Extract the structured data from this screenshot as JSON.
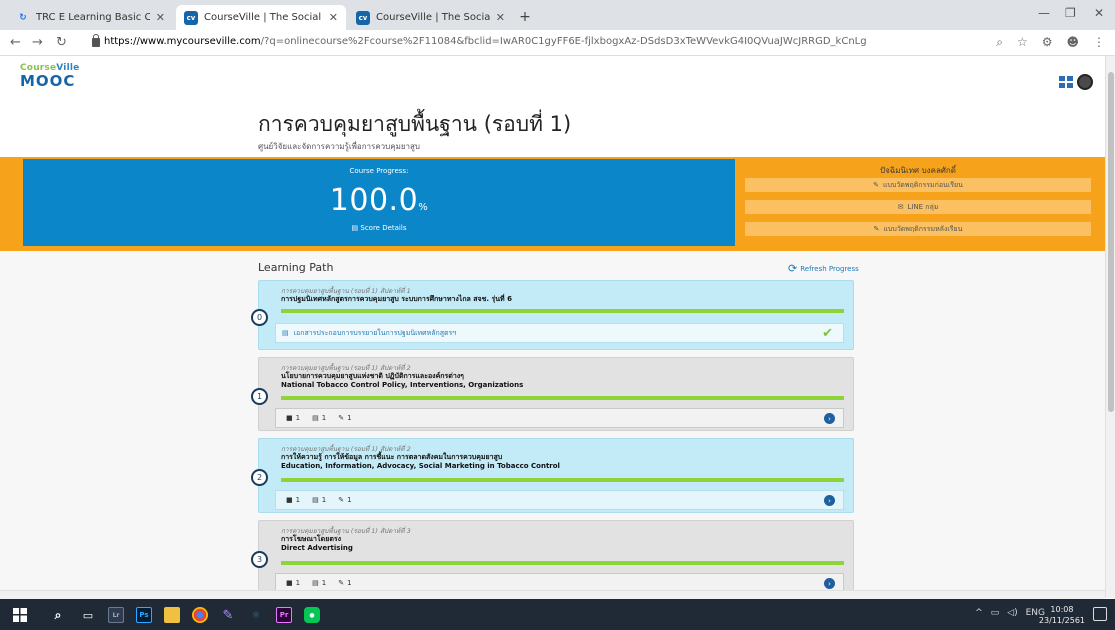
{
  "browser": {
    "tabs": [
      {
        "title": "TRC E Learning Basic Course",
        "active": false,
        "favicon": "refresh-icon"
      },
      {
        "title": "CourseVille | The Social LMS of C",
        "active": true,
        "favicon": "courseville-icon"
      },
      {
        "title": "CourseVille | The Social LMS of C",
        "active": false,
        "favicon": "courseville-icon"
      }
    ],
    "url_host": "https://www.mycourseville.com",
    "url_rest": "/?q=onlinecourse%2Fcourse%2F11084&fbclid=IwAR0C1gyFF6E-fjlxbogxAz-DSdsD3xTeWVevkG4I0QVuaJWcJRRGD_kCnLg"
  },
  "site": {
    "logo_line1_a": "Course",
    "logo_line1_b": "Ville",
    "logo_line2": "MOOC"
  },
  "course": {
    "title": "การควบคุมยาสูบพื้นฐาน (รอบที่ 1)",
    "subtitle": "ศูนย์วิจัยและจัดการความรู้เพื่อการควบคุมยาสูบ"
  },
  "progress": {
    "label": "Course Progress:",
    "value": "100.0",
    "unit": "%",
    "score_details": "Score Details"
  },
  "right_panel": {
    "title": "ปัจฉิมนิเทศ บงคลศักดิ์",
    "buttons": [
      {
        "icon": "edit-icon",
        "label": "แบบวัดพฤติกรรมก่อนเรียน"
      },
      {
        "icon": "chat-icon",
        "label": "LINE กลุ่ม"
      },
      {
        "icon": "edit-icon",
        "label": "แบบวัดพฤติกรรมหลังเรียน"
      }
    ]
  },
  "learning_path": {
    "heading": "Learning Path",
    "refresh_label": "Refresh Progress",
    "modules": [
      {
        "number": "0",
        "sub": "การควบคุมยาสูบพื้นฐาน (รอบที่ 1) สัปดาห์ที่ 1",
        "title_th": "การปฐมนิเทศหลักสูตรการควบคุมยาสูบ ระบบการศึกษาทางไกล สจช. รุ่นที่ 6",
        "title_en": "",
        "item": "เอกสารประกอบการบรรยายในการปฐมนิเทศหลักสูตรฯ",
        "progress": 1.0,
        "style": "blue"
      },
      {
        "number": "1",
        "sub": "การควบคุมยาสูบพื้นฐาน (รอบที่ 1) สัปดาห์ที่ 2",
        "title_th": "นโยบายการควบคุมยาสูบแห่งชาติ ปฏิบัติการและองค์กรต่างๆ",
        "title_en": "National Tobacco Control Policy, Interventions, Organizations",
        "stats": [
          "1",
          "1",
          "1"
        ],
        "progress": 1.0,
        "style": "gray"
      },
      {
        "number": "2",
        "sub": "การควบคุมยาสูบพื้นฐาน (รอบที่ 1) สัปดาห์ที่ 2",
        "title_th": "การให้ความรู้ การให้ข้อมูล การชี้แนะ การตลาดสังคมในการควบคุมยาสูบ",
        "title_en": "Education, Information, Advocacy, Social Marketing in Tobacco Control",
        "stats": [
          "1",
          "1",
          "1"
        ],
        "progress": 1.0,
        "style": "blue"
      },
      {
        "number": "3",
        "sub": "การควบคุมยาสูบพื้นฐาน (รอบที่ 1) สัปดาห์ที่ 3",
        "title_th": "การโฆษณาโดยตรง",
        "title_en": "Direct Advertising",
        "stats": [
          "1",
          "1",
          "1"
        ],
        "progress": 1.0,
        "style": "gray"
      }
    ]
  },
  "taskbar": {
    "lang": "ENG",
    "time": "10:08",
    "date": "23/11/2561"
  }
}
